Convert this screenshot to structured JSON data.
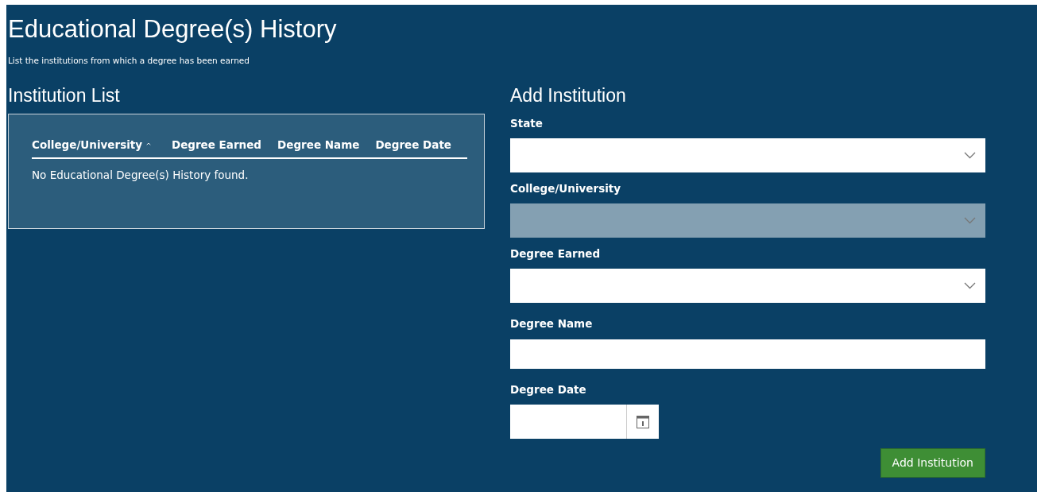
{
  "title": "Educational Degree(s) History",
  "subtitle": "List the institutions from which a degree has been earned",
  "institution_list": {
    "heading": "Institution List",
    "columns": [
      {
        "label": "College/University",
        "sorted": true
      },
      {
        "label": "Degree Earned",
        "sorted": false
      },
      {
        "label": "Degree Name",
        "sorted": false
      },
      {
        "label": "Degree Date",
        "sorted": false
      }
    ],
    "empty_message": "No Educational Degree(s) History found."
  },
  "add_institution": {
    "heading": "Add Institution",
    "fields": [
      {
        "label": "State",
        "kind": "select",
        "disabled": false
      },
      {
        "label": "College/University",
        "kind": "select",
        "disabled": true
      },
      {
        "label": "Degree Earned",
        "kind": "select",
        "disabled": false
      },
      {
        "label": "Degree Name",
        "kind": "text",
        "disabled": false
      },
      {
        "label": "Degree Date",
        "kind": "date",
        "disabled": false
      }
    ],
    "button": "Add Institution"
  }
}
